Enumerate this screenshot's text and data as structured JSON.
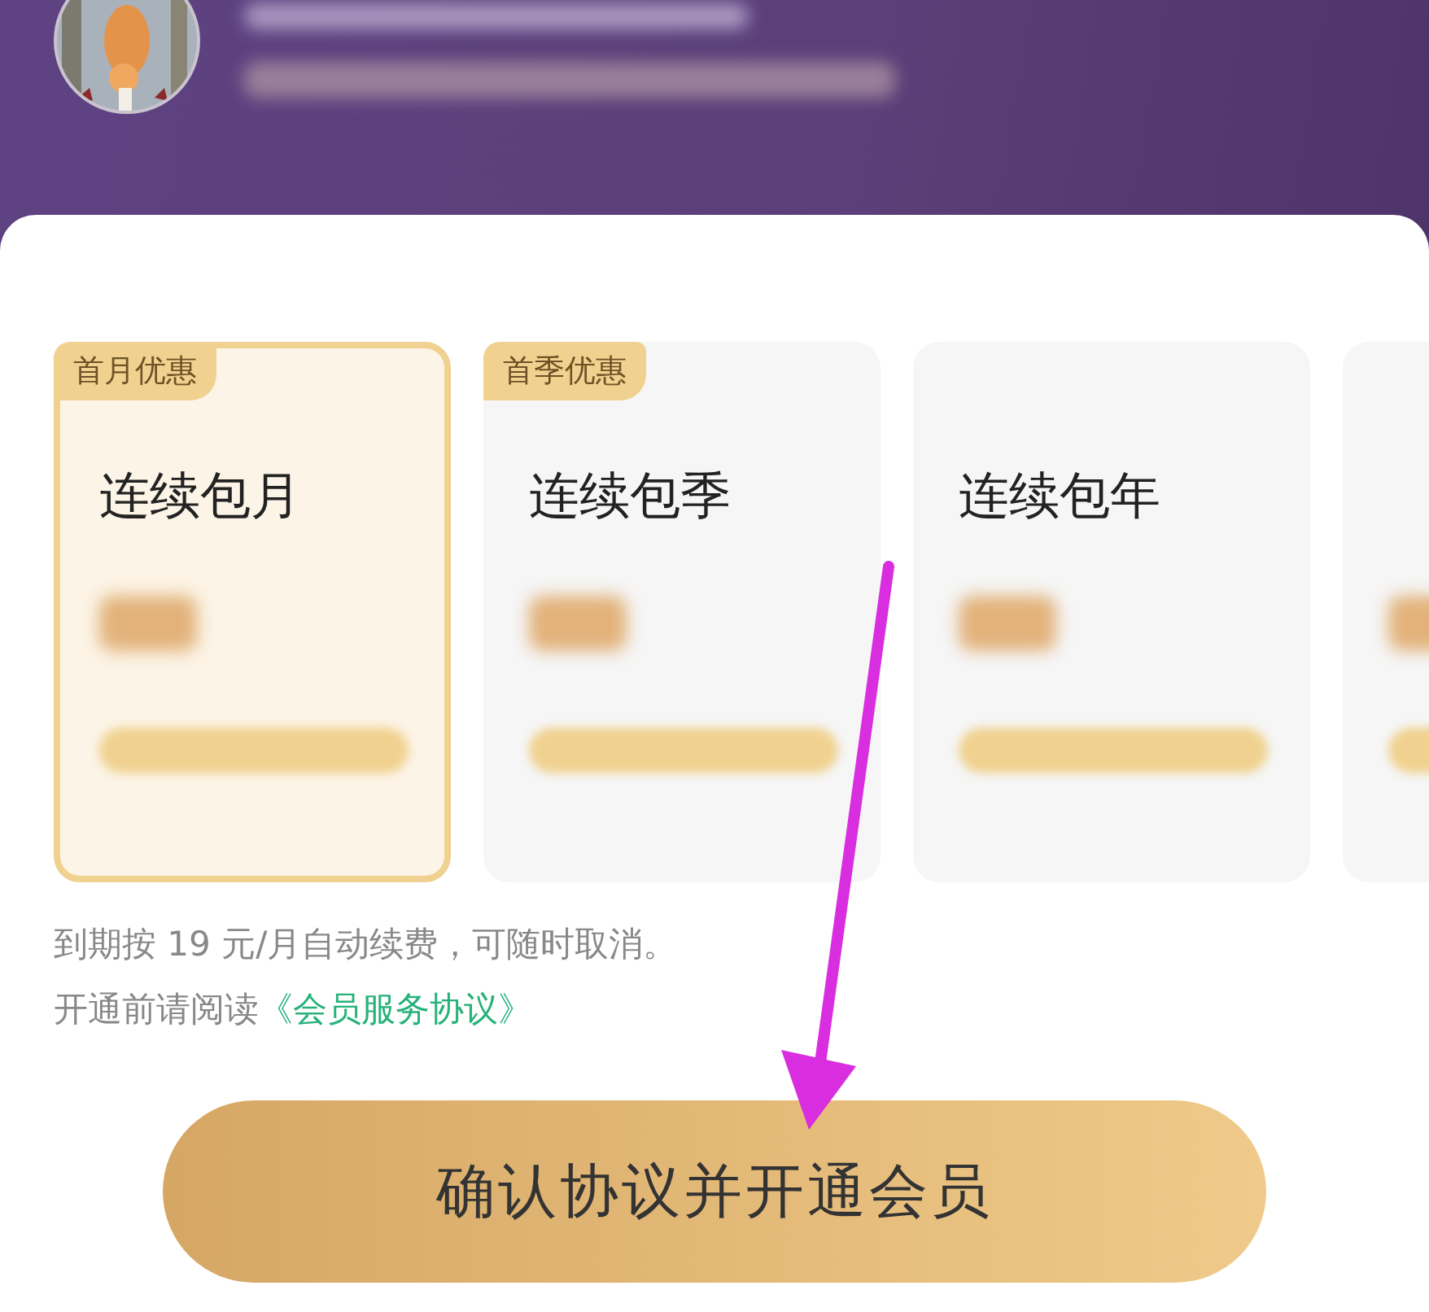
{
  "plans": [
    {
      "badge": "首月优惠",
      "title": "连续包月",
      "selected": true
    },
    {
      "badge": "首季优惠",
      "title": "连续包季",
      "selected": false
    },
    {
      "title": "连续包年",
      "selected": false
    },
    {
      "selected": false
    }
  ],
  "renewal_note": "到期按 19 元/月自动续费，可随时取消。",
  "agreement": {
    "prefix": "开通前请阅读",
    "link": "《会员服务协议》"
  },
  "confirm_button": "确认协议并开通会员"
}
